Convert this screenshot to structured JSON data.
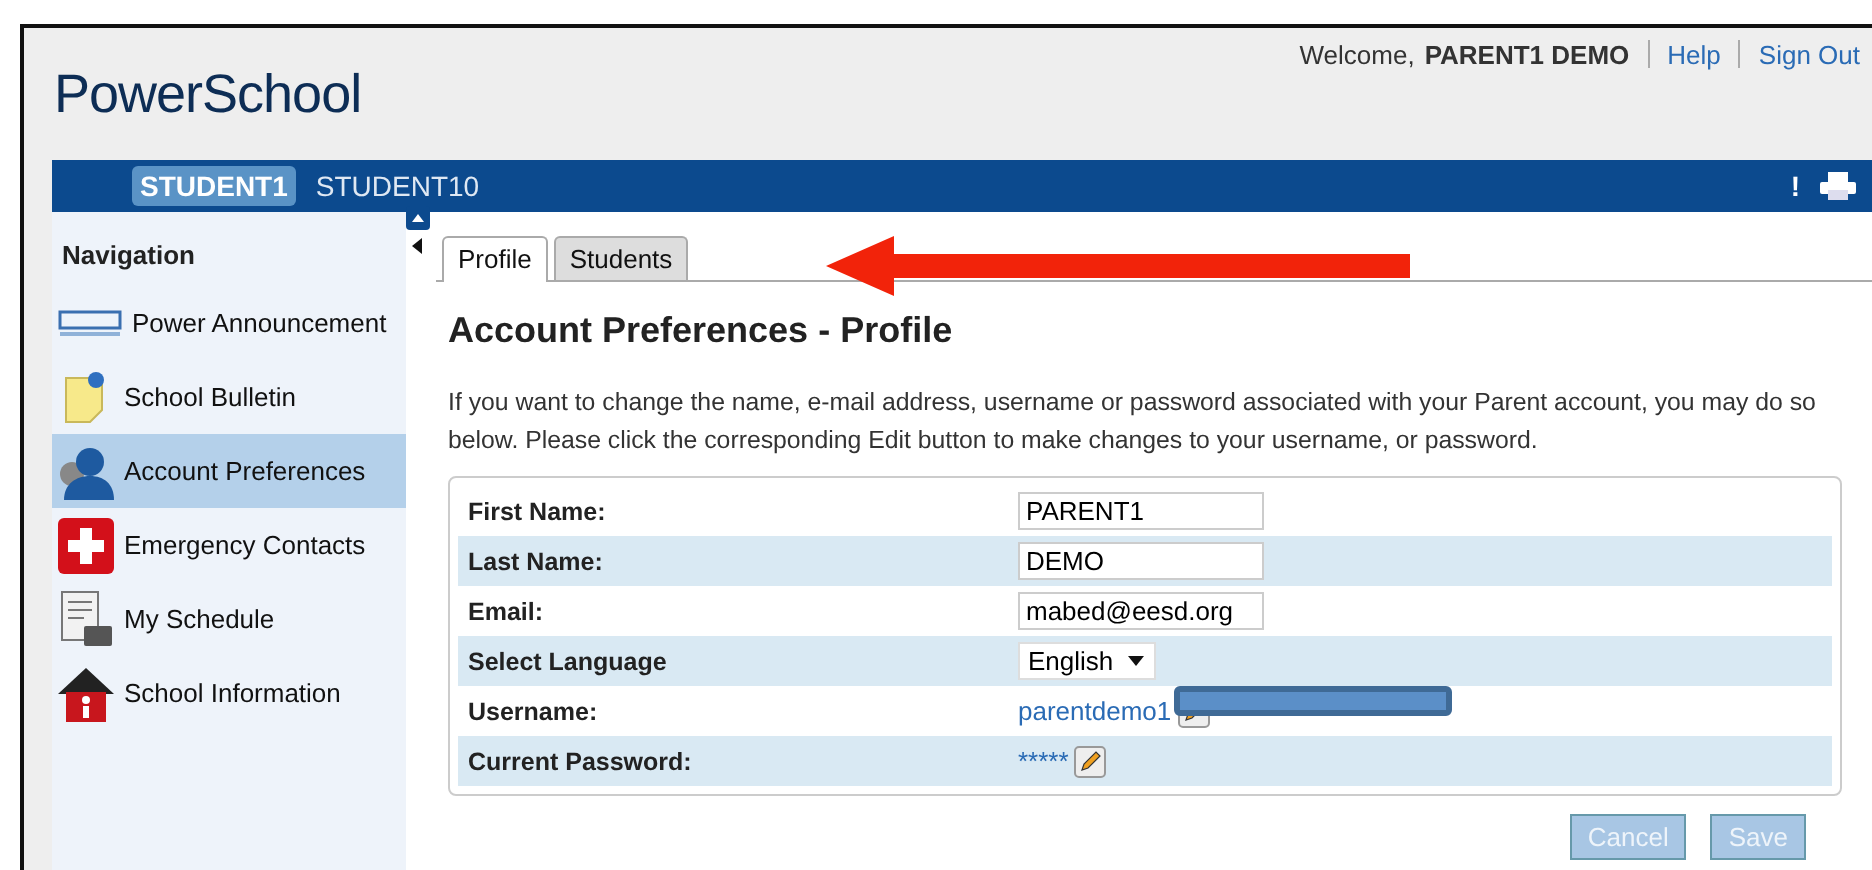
{
  "header": {
    "logo": "PowerSchool",
    "welcome": "Welcome,",
    "user": "PARENT1 DEMO",
    "links": [
      "Help",
      "Sign Out"
    ]
  },
  "students": [
    {
      "name": "STUDENT1",
      "selected": true
    },
    {
      "name": "STUDENT10",
      "selected": false
    }
  ],
  "toolbar": {
    "alert": "!"
  },
  "navigation": {
    "title": "Navigation",
    "items": [
      {
        "label": "Power Announcement",
        "kind": "announcement",
        "selected": false
      },
      {
        "label": "School Bulletin",
        "kind": "note",
        "selected": false
      },
      {
        "label": "Account Preferences",
        "kind": "person",
        "selected": true
      },
      {
        "label": "Emergency Contacts",
        "kind": "cross",
        "selected": false
      },
      {
        "label": "My Schedule",
        "kind": "schedule",
        "selected": false
      },
      {
        "label": "School Information",
        "kind": "house",
        "selected": false
      }
    ]
  },
  "tabs": [
    {
      "label": "Profile",
      "selected": true
    },
    {
      "label": "Students",
      "selected": false
    }
  ],
  "heading": "Account Preferences - Profile",
  "intro": "If you want to change the name, e-mail address, username or password associated with your Parent account, you may do so below. Please click the corresponding Edit button to make changes to your username, or password.",
  "fields": [
    {
      "label": "First Name:",
      "kind": "input",
      "value": "PARENT1"
    },
    {
      "label": "Last Name:",
      "kind": "input",
      "value": "DEMO"
    },
    {
      "label": "Email:",
      "kind": "input",
      "value": "mabed@eesd.org"
    },
    {
      "label": "Select Language",
      "kind": "select",
      "value": "English"
    },
    {
      "label": "Username:",
      "kind": "link",
      "value": "parentdemo1"
    },
    {
      "label": "Current Password:",
      "kind": "link",
      "value": "*****"
    }
  ],
  "buttons": [
    {
      "label": "Cancel",
      "disabled": true
    },
    {
      "label": "Save",
      "disabled": true
    }
  ]
}
